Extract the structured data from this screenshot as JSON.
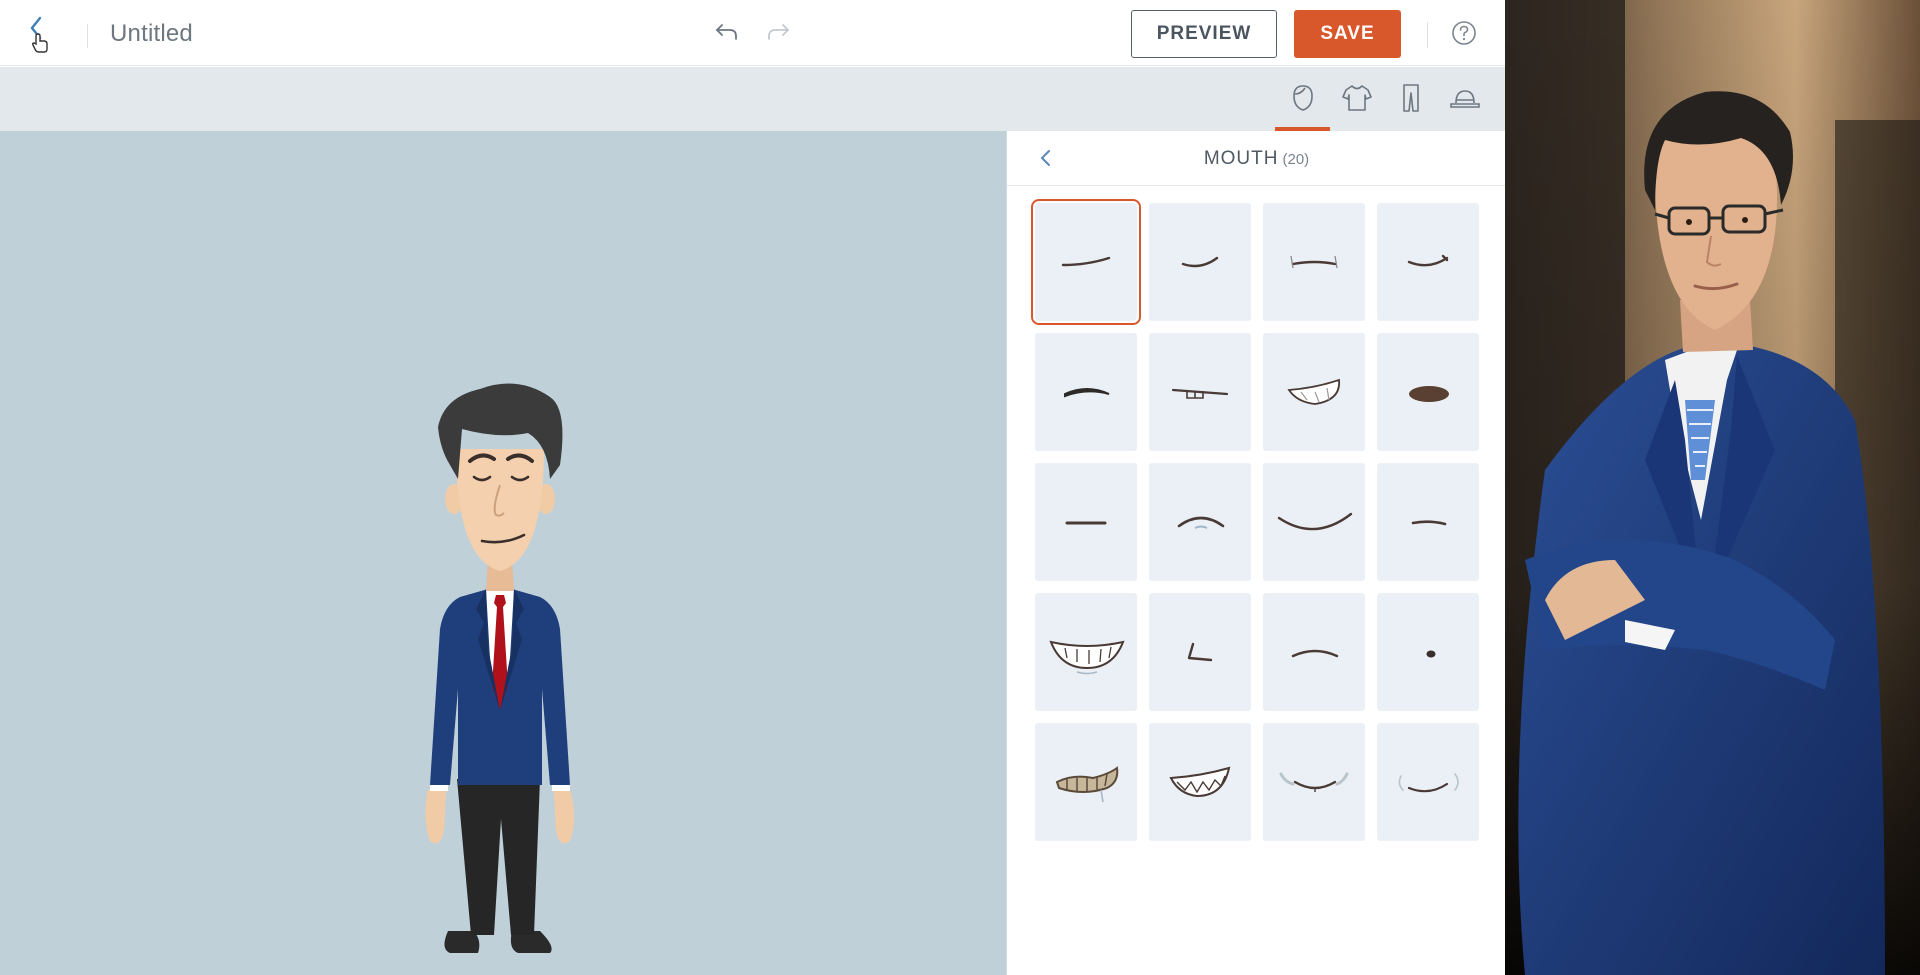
{
  "header": {
    "title": "Untitled",
    "preview_label": "PREVIEW",
    "save_label": "SAVE"
  },
  "icons": {
    "back": "back-chevron-icon",
    "undo": "undo-icon",
    "redo": "redo-icon",
    "help": "help-icon"
  },
  "categories": [
    "face-icon",
    "shirt-icon",
    "pants-icon",
    "hat-icon"
  ],
  "active_category": "face-icon",
  "panel": {
    "title": "MOUTH",
    "count": "(20)",
    "selected_index": 0,
    "item_count": 20
  },
  "colors": {
    "accent": "#d9582b",
    "canvas_bg": "#bfd0d9",
    "tile_bg": "#eaf0f5",
    "mouth_stroke": "#4a3a35"
  }
}
